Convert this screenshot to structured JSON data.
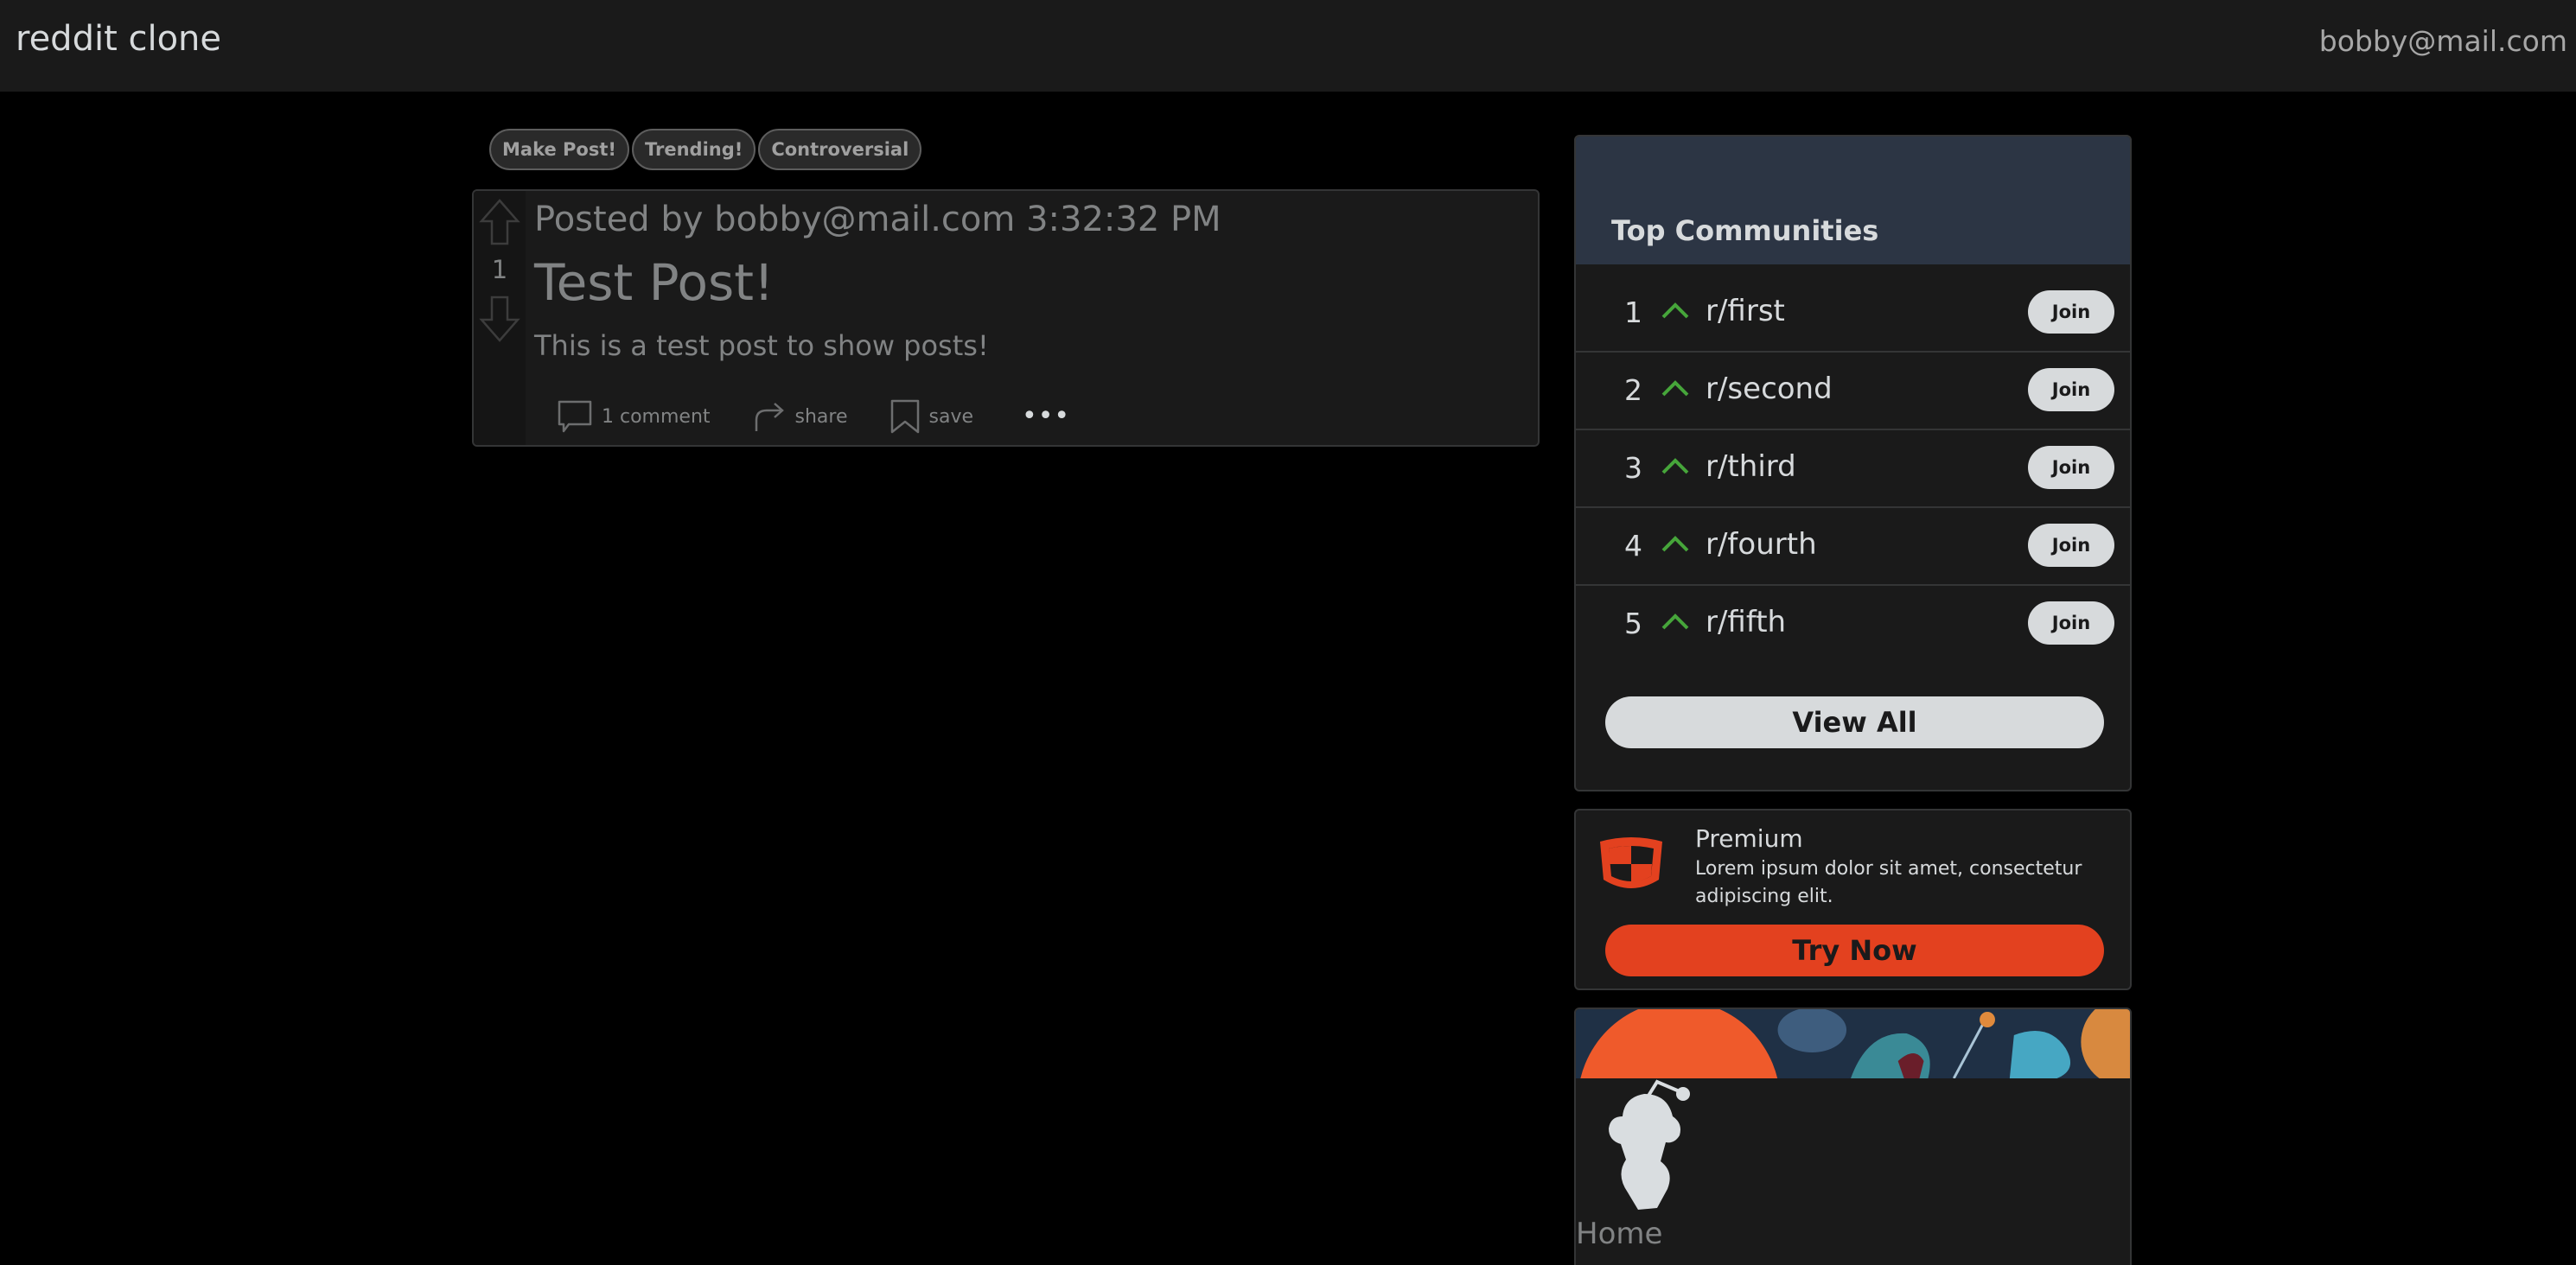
{
  "header": {
    "brand": "reddit clone",
    "user_email": "bobby@mail.com"
  },
  "filters": [
    "Make Post!",
    "Trending!",
    "Controversial"
  ],
  "post": {
    "vote_count": "1",
    "meta": "Posted by bobby@mail.com 3:32:32 PM",
    "title": "Test Post!",
    "body": "This is a test post to show posts!",
    "actions": {
      "comments": "1 comment",
      "share": "share",
      "save": "save"
    }
  },
  "communities": {
    "title": "Top Communities",
    "items": [
      {
        "rank": "1",
        "name": "r/first",
        "join": "Join"
      },
      {
        "rank": "2",
        "name": "r/second",
        "join": "Join"
      },
      {
        "rank": "3",
        "name": "r/third",
        "join": "Join"
      },
      {
        "rank": "4",
        "name": "r/fourth",
        "join": "Join"
      },
      {
        "rank": "5",
        "name": "r/fifth",
        "join": "Join"
      }
    ],
    "view_all": "View All"
  },
  "premium": {
    "title": "Premium",
    "description": "Lorem ipsum dolor sit amet, consectetur adipiscing elit.",
    "button": "Try Now"
  },
  "home": {
    "label": "Home"
  },
  "colors": {
    "page_bg": "#000000",
    "panel_bg": "#1a1a1a",
    "community_header": "#2c3544",
    "upvote_green": "#46a53a",
    "premium_orange": "#e3411f"
  }
}
